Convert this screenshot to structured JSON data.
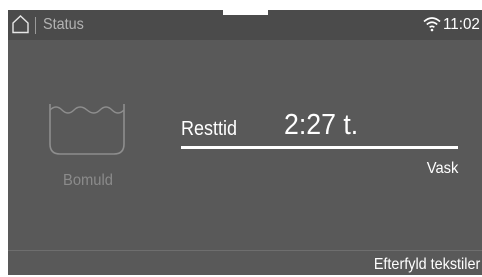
{
  "status_bar": {
    "home_icon": "home-icon",
    "title": "Status",
    "wifi_icon": "wifi-icon",
    "time": "11:02"
  },
  "program": {
    "icon": "washtub-icon",
    "name": "Bomuld"
  },
  "remaining": {
    "label": "Resttid",
    "value": "2:27 t.",
    "phase": "Vask",
    "progress_fraction": 1.0
  },
  "footer": {
    "action_label": "Efterfyld tekstiler"
  },
  "colors": {
    "screen_bg": "#595959",
    "topbar_bg": "#4b4b4b",
    "text_primary": "#ffffff",
    "text_muted": "#8b8b8b"
  }
}
